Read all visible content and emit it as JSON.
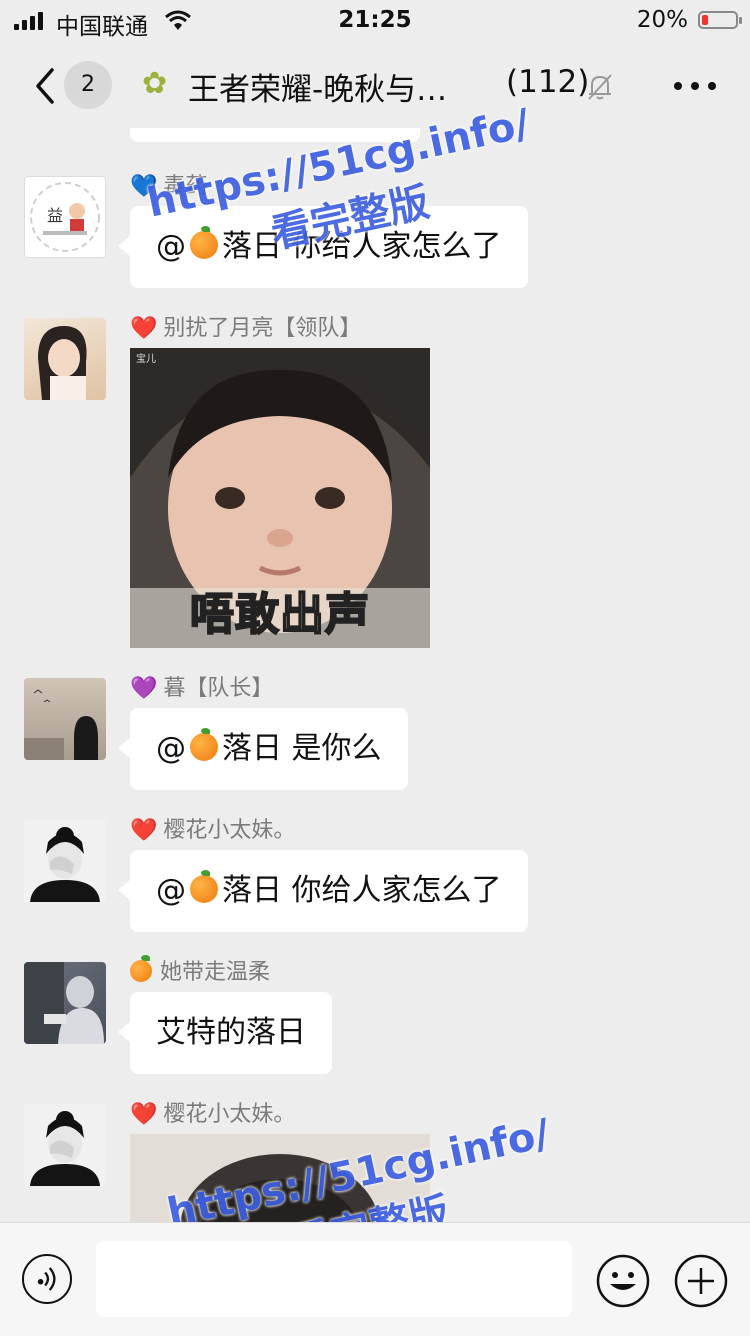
{
  "status_bar": {
    "carrier": "中国联通",
    "time": "21:25",
    "battery_percent": "20%",
    "battery_level": 0.2
  },
  "header": {
    "back_count": "2",
    "title": "王者荣耀-晚秋与…",
    "member_count": "(112)"
  },
  "messages": [
    {
      "sender": "毒药",
      "heart": "💙",
      "prefix": "@",
      "mention": "落日",
      "text": " 你给人家怎么了"
    },
    {
      "sender": "别扰了月亮【领队】",
      "heart": "❤️",
      "image_caption": "唔敢出声",
      "sticker_tag": "宝儿"
    },
    {
      "sender": "暮【队长】",
      "heart": "💜",
      "prefix": "@",
      "mention": "落日",
      "text": " 是你么"
    },
    {
      "sender": "樱花小太妹。",
      "heart": "❤️",
      "prefix": "@",
      "mention": "落日",
      "text": " 你给人家怎么了"
    },
    {
      "sender": "她带走温柔",
      "text": "艾特的落日"
    },
    {
      "sender": "樱花小太妹。",
      "heart": "❤️"
    }
  ],
  "watermark": {
    "url": "https://51cg.info/",
    "caption": "看完整版"
  },
  "icons": [
    "back-icon",
    "group-icon",
    "mute-icon",
    "more-icon",
    "voice-icon",
    "emoji-icon",
    "add-icon",
    "orange-emoji-icon"
  ],
  "colors": {
    "background": "#ededed",
    "bubble": "#ffffff",
    "watermark": "#3e5fe0",
    "battery_low": "#e33333"
  }
}
